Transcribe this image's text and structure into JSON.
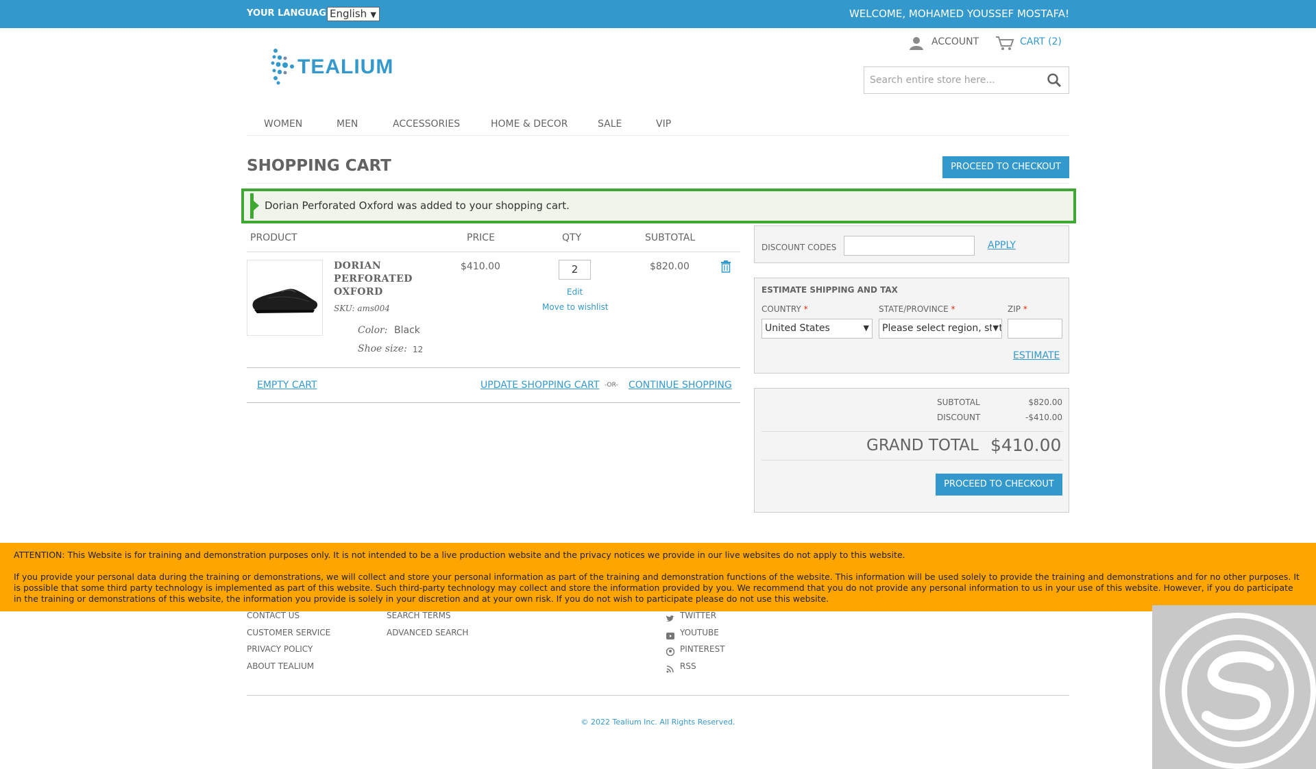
{
  "topbar": {
    "language_label": "YOUR LANGUAGE:",
    "language_value": "English",
    "welcome": "WELCOME, MOHAMED YOUSSEF MOSTAFA!"
  },
  "header": {
    "logo_text": "TEALIUM",
    "account_label": "ACCOUNT",
    "cart_label": "CART (2)",
    "search_placeholder": "Search entire store here..."
  },
  "nav": [
    "WOMEN",
    "MEN",
    "ACCESSORIES",
    "HOME & DECOR",
    "SALE",
    "VIP"
  ],
  "page": {
    "title": "SHOPPING CART",
    "checkout_button": "PROCEED TO CHECKOUT",
    "success_message": "Dorian Perforated Oxford was added to your shopping cart."
  },
  "cart_table": {
    "headers": [
      "PRODUCT",
      "PRICE",
      "QTY",
      "SUBTOTAL"
    ],
    "item": {
      "name": "DORIAN PERFORATED OXFORD",
      "sku_label": "SKU:",
      "sku": "ams004",
      "options": [
        {
          "label": "Color:",
          "value": "Black"
        },
        {
          "label": "Shoe size:",
          "value": "12"
        }
      ],
      "price": "$410.00",
      "qty": "2",
      "edit": "Edit",
      "wishlist": "Move to wishlist",
      "subtotal": "$820.00"
    },
    "actions": {
      "empty": "EMPTY CART",
      "update": "UPDATE SHOPPING CART",
      "or": "-OR-",
      "continue": "CONTINUE SHOPPING"
    }
  },
  "discount": {
    "label": "DISCOUNT CODES",
    "value": "",
    "apply": "APPLY"
  },
  "shipping": {
    "title": "ESTIMATE SHIPPING AND TAX",
    "country_label": "COUNTRY",
    "country_value": "United States",
    "state_label": "STATE/PROVINCE",
    "state_value": "Please select region, state or province",
    "zip_label": "ZIP",
    "zip_value": "",
    "estimate": "ESTIMATE",
    "required_mark": "*"
  },
  "totals": {
    "subtotal_label": "SUBTOTAL",
    "subtotal_value": "$820.00",
    "discount_label": "DISCOUNT",
    "discount_value": "-$410.00",
    "grand_label": "GRAND TOTAL",
    "grand_value": "$410.00",
    "checkout_button": "PROCEED TO CHECKOUT"
  },
  "attention": {
    "line1": "ATTENTION: This Website is for training and demonstration purposes only. It is not intended to be a live production website and the privacy notices we provide in our live websites do not apply to this website.",
    "line2": "If you provide your personal data during the training or demonstrations, we will collect and store your personal information as part of the training and demonstration functions of the website. This information will be used solely to provide the training and demonstrations and for no other purposes. It is possible that some third party technology is implemented as part of this website. Such third-party technology may collect and store the information provided by you. We recommend that you do not provide any personal information to us in your use of this website. However, if you do participate in the training or demonstrations of this website, the information you provide is solely in your discretion and at your own risk. If you do not wish to participate please do not use this website."
  },
  "footer": {
    "col1": [
      "CONTACT US",
      "CUSTOMER SERVICE",
      "PRIVACY POLICY",
      "ABOUT TEALIUM"
    ],
    "col2": [
      "SEARCH TERMS",
      "ADVANCED SEARCH"
    ],
    "social": [
      "TWITTER",
      "YOUTUBE",
      "PINTEREST",
      "RSS"
    ],
    "copyright": "© 2022 Tealium Inc. All Rights Reserved."
  },
  "colors": {
    "brand_blue": "#3399cc",
    "success_green": "#3fa832",
    "attention_orange": "#ffa500"
  }
}
